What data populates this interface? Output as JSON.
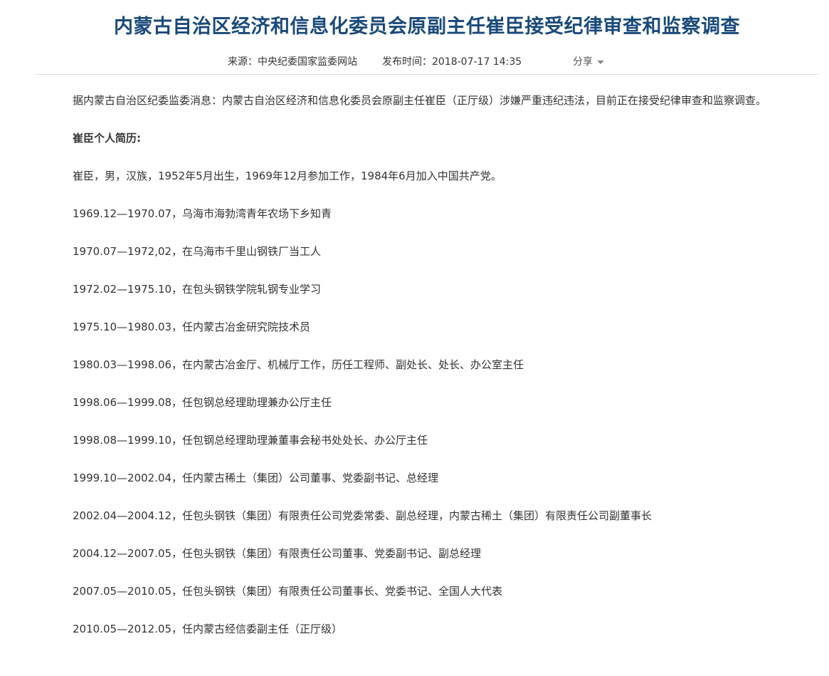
{
  "article": {
    "title": "内蒙古自治区经济和信息化委员会原副主任崔臣接受纪律审查和监察调查",
    "source": "来源：中央纪委国家监委网站",
    "publish_time": "发布时间：2018-07-17 14:35",
    "share_label": "分享",
    "lead": "据内蒙古自治区纪委监委消息：内蒙古自治区经济和信息化委员会原副主任崔臣（正厅级）涉嫌严重违纪违法，目前正在接受纪律审查和监察调查。",
    "resume_heading": "崔臣个人简历:",
    "bio": "崔臣，男，汉族，1952年5月出生，1969年12月参加工作，1984年6月加入中国共产党。",
    "resume": [
      "1969.12—1970.07，乌海市海勃湾青年农场下乡知青",
      "1970.07—1972,02，在乌海市千里山钢铁厂当工人",
      "1972.02—1975.10，在包头钢铁学院轧钢专业学习",
      "1975.10—1980.03，任内蒙古冶金研究院技术员",
      "1980.03—1998.06，在内蒙古冶金厅、机械厅工作，历任工程师、副处长、处长、办公室主任",
      "1998.06—1999.08，任包钢总经理助理兼办公厅主任",
      "1998.08—1999.10，任包钢总经理助理兼董事会秘书处处长、办公厅主任",
      "1999.10—2002.04，任内蒙古稀土（集团）公司董事、党委副书记、总经理",
      "2002.04—2004.12，任包头钢铁（集团）有限责任公司党委常委、副总经理，内蒙古稀土（集团）有限责任公司副董事长",
      "2004.12—2007.05，任包头钢铁（集团）有限责任公司董事、党委副书记、副总经理",
      "2007.05—2010.05，任包头钢铁（集团）有限责任公司董事长、党委书记、全国人大代表",
      "2010.05—2012.05，任内蒙古经信委副主任（正厅级）"
    ]
  },
  "colors": {
    "title": "#1a4a7a",
    "text": "#333333",
    "divider": "#dddddd"
  }
}
